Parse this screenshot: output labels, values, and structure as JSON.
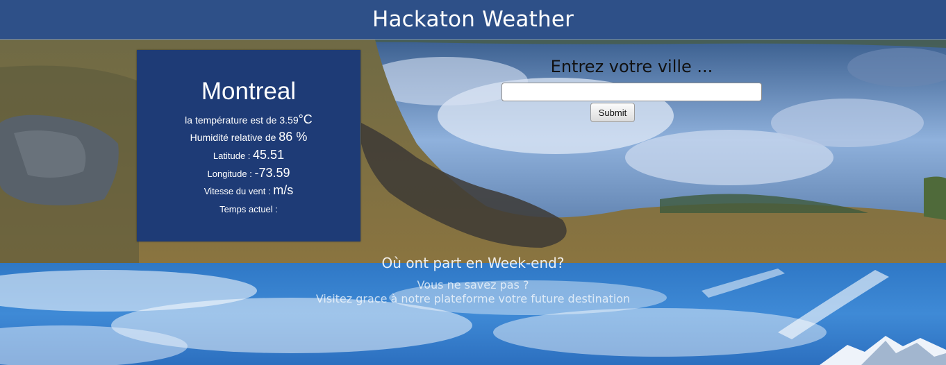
{
  "header": {
    "title": "Hackaton Weather"
  },
  "weather": {
    "city": "Montreal",
    "temperature_label": "la température est de ",
    "temperature_value": "3.59",
    "temperature_unit": "°C",
    "humidity_label": "Humidité relative de ",
    "humidity_value": "86 %",
    "latitude_label": "Latitude : ",
    "latitude_value": "45.51",
    "longitude_label": "Longitude : ",
    "longitude_value": "-73.59",
    "wind_label": "Vitesse du vent : ",
    "wind_value": "m/s",
    "current_time_label": "Temps actuel :"
  },
  "search": {
    "label": "Entrez votre ville ...",
    "input_value": "",
    "submit_label": "Submit"
  },
  "promo": {
    "title": "Où ont part en Week-end?",
    "line1": "Vous ne savez pas ?",
    "line2": "Visitez grace à notre plateforme votre future destination"
  },
  "colors": {
    "header_bg": "#2e5088",
    "card_bg": "#1e3b76"
  }
}
